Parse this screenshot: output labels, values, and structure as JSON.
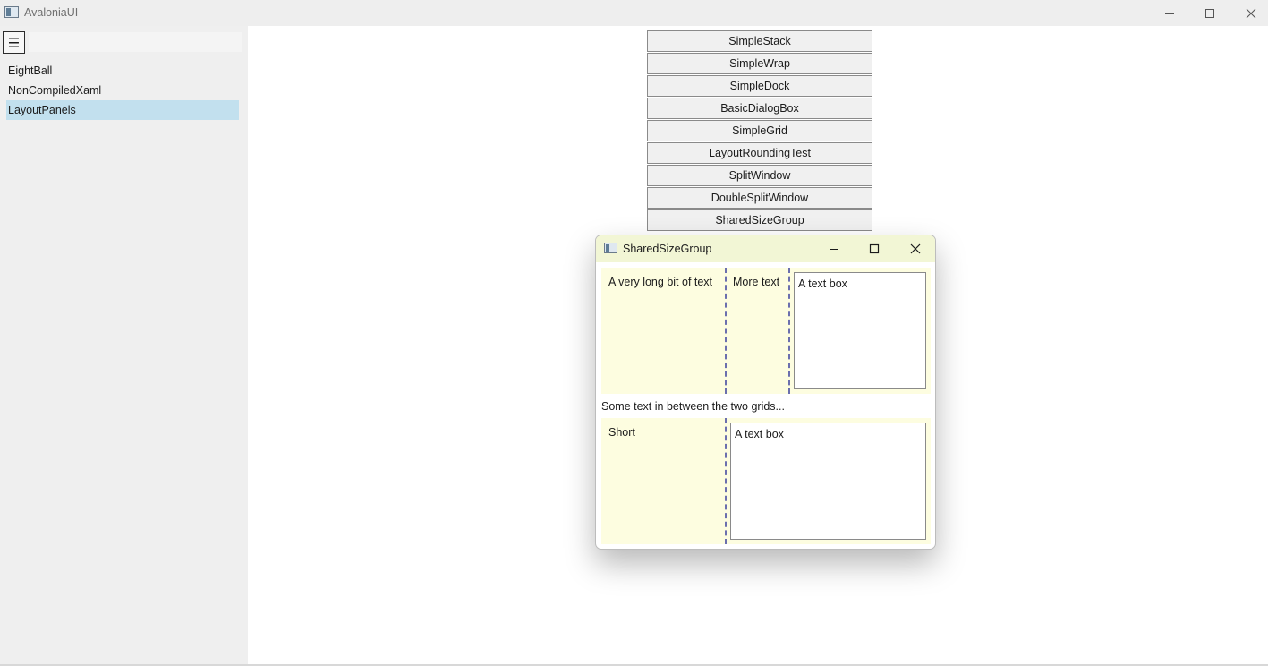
{
  "window": {
    "title": "AvaloniaUI",
    "icon": "app-window-icon",
    "controls": [
      "minimize-icon",
      "maximize-icon",
      "close-icon"
    ]
  },
  "sidebar": {
    "menu_icon": "☰",
    "search_value": "",
    "items": [
      {
        "label": "EightBall",
        "selected": false
      },
      {
        "label": "NonCompiledXaml",
        "selected": false
      },
      {
        "label": "LayoutPanels",
        "selected": true
      }
    ]
  },
  "content": {
    "buttons": [
      {
        "label": "SimpleStack"
      },
      {
        "label": "SimpleWrap"
      },
      {
        "label": "SimpleDock"
      },
      {
        "label": "BasicDialogBox"
      },
      {
        "label": "SimpleGrid"
      },
      {
        "label": "LayoutRoundingTest"
      },
      {
        "label": "SplitWindow"
      },
      {
        "label": "DoubleSplitWindow"
      },
      {
        "label": "SharedSizeGroup"
      }
    ]
  },
  "dialog": {
    "title": "SharedSizeGroup",
    "grid1": {
      "col1_text": "A very long bit of text",
      "col2_text": "More text",
      "textbox_value": "A text box"
    },
    "between_text": "Some text in between the two grids...",
    "grid2": {
      "col1_text": "Short",
      "textbox_value": "A text box"
    }
  },
  "colors": {
    "selected_item": "#c2e0ee",
    "grid_background": "#fdfde0",
    "dialog_titlebar": "#f2f6d5",
    "splitter": "#6b6fae"
  }
}
